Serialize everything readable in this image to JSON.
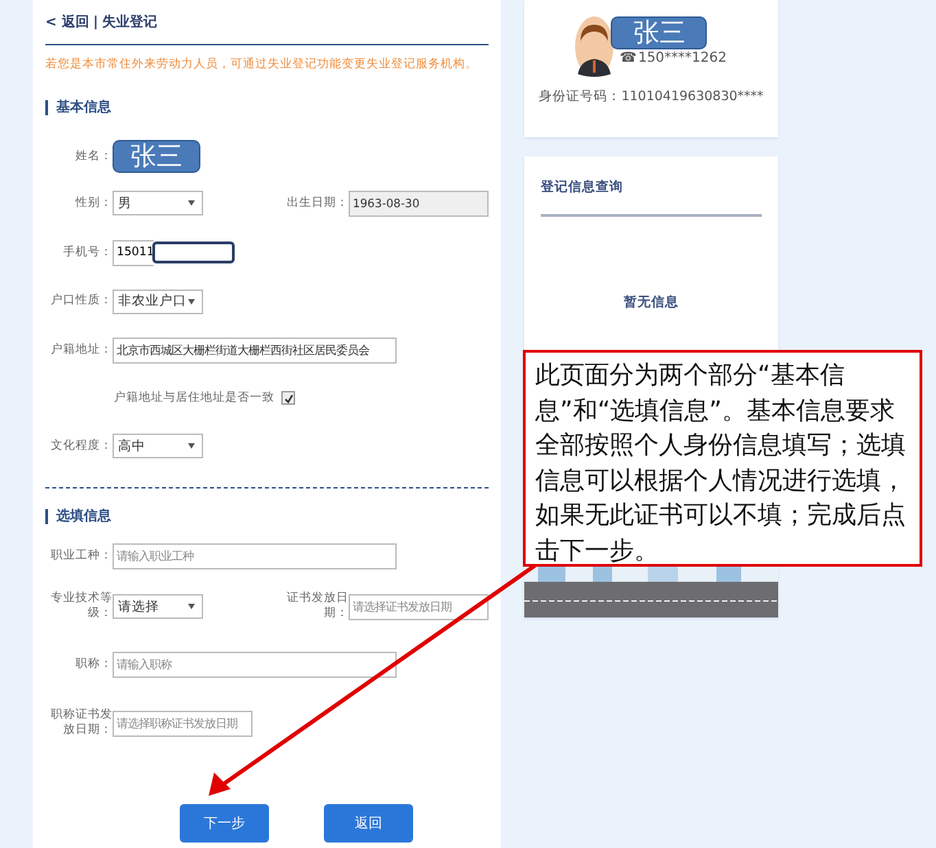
{
  "breadcrumb": {
    "back": "< 返回",
    "separator": "|",
    "current": "失业登记"
  },
  "notice": "若您是本市常住外来劳动力人员，可通过失业登记功能变更失业登记服务机构。",
  "sections": [
    {
      "title": "基本信息",
      "rows": [
        {
          "fields": [
            {
              "kind": "badge",
              "label": "姓名：",
              "value": "张三"
            }
          ]
        },
        {
          "fields": [
            {
              "kind": "select",
              "label": "性别：",
              "value": "男"
            },
            {
              "kind": "readonly",
              "label": "出生日期：",
              "value": "1963-08-30"
            }
          ]
        },
        {
          "fields": [
            {
              "kind": "masked",
              "label": "手机号：",
              "value": "15011"
            }
          ]
        },
        {
          "fields": [
            {
              "kind": "select",
              "label": "户口性质：",
              "value": "非农业户口"
            }
          ]
        },
        {
          "fields": [
            {
              "kind": "text",
              "label": "户籍地址：",
              "value": "北京市西城区大栅栏街道大栅栏西街社区居民委员会"
            }
          ]
        },
        {
          "fields": [
            {
              "kind": "checkbox",
              "label": "户籍地址与居住地址是否一致",
              "checked": true
            }
          ]
        },
        {
          "fields": [
            {
              "kind": "select",
              "label": "文化程度：",
              "value": "高中"
            }
          ]
        }
      ]
    },
    {
      "title": "选填信息",
      "rows": [
        {
          "fields": [
            {
              "kind": "text",
              "label": "职业工种：",
              "placeholder": "请输入职业工种"
            }
          ]
        },
        {
          "fields": [
            {
              "kind": "select",
              "label": "专业技术等级：",
              "value": "请选择"
            },
            {
              "kind": "date",
              "label": "证书发放日期：",
              "placeholder": "请选择证书发放日期"
            }
          ]
        },
        {
          "fields": [
            {
              "kind": "text",
              "label": "职称：",
              "placeholder": "请输入职称"
            }
          ]
        },
        {
          "fields": [
            {
              "kind": "date",
              "label": "职称证书发放日期：",
              "placeholder": "请选择职称证书发放日期"
            }
          ]
        }
      ]
    }
  ],
  "buttons": [
    "下一步",
    "返回"
  ],
  "profile": {
    "name": "张三",
    "phone_icon": "☎",
    "phone": "150****1262",
    "id_number": "身份证号码：11010419630830****"
  },
  "query": {
    "title": "登记信息查询",
    "empty": "暂无信息"
  },
  "callout": "此页面分为两个部分“基本信息”和“选填信息”。基本信息要求全部按照个人身份信息填写；选填信息可以根据个人情况进行选填，如果无此证书可以不填；完成后点击下一步。"
}
